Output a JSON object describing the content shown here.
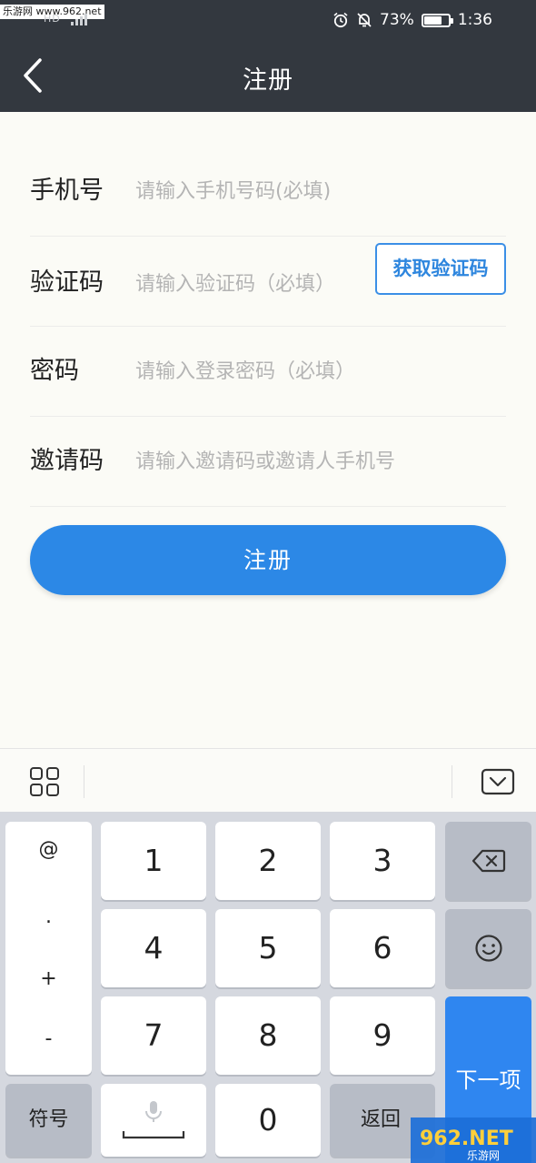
{
  "status_bar": {
    "watermark": "乐游网 www.962.net",
    "network": "HD",
    "battery_percent": "73%",
    "battery_level": 0.73,
    "time": "1:36",
    "icons": [
      "alarm-icon",
      "bell-off-icon",
      "battery-icon",
      "signal-icon"
    ]
  },
  "header": {
    "title": "注册",
    "back_icon": "chevron-left-icon",
    "background": "#33383f"
  },
  "form": {
    "phone": {
      "label": "手机号",
      "placeholder": "请输入手机号码(必填)",
      "value": ""
    },
    "code": {
      "label": "验证码",
      "placeholder": "请输入验证码（必填）",
      "value": "",
      "button_label": "获取验证码"
    },
    "password": {
      "label": "密码",
      "placeholder": "请输入登录密码（必填）",
      "value": ""
    },
    "invite": {
      "label": "邀请码",
      "placeholder": "请输入邀请码或邀请人手机号",
      "value": ""
    }
  },
  "register_button": {
    "label": "注册",
    "color": "#2c88e6"
  },
  "keyboard": {
    "toolbar_icons": [
      "grid-icon",
      "keyboard-hide-icon"
    ],
    "symbols": [
      "@",
      ".",
      "+",
      "-"
    ],
    "keys": [
      "1",
      "2",
      "3",
      "4",
      "5",
      "6",
      "7",
      "8",
      "9",
      "0"
    ],
    "symbol_key": "符号",
    "return_key": "返回",
    "next_key": "下一项",
    "backspace_icon": "backspace-icon",
    "emoji_icon": "emoji-icon",
    "mic_icon": "microphone-icon",
    "accent": "#2f86f0"
  },
  "logo": {
    "text": "962.NET",
    "subtext": "乐游网"
  }
}
